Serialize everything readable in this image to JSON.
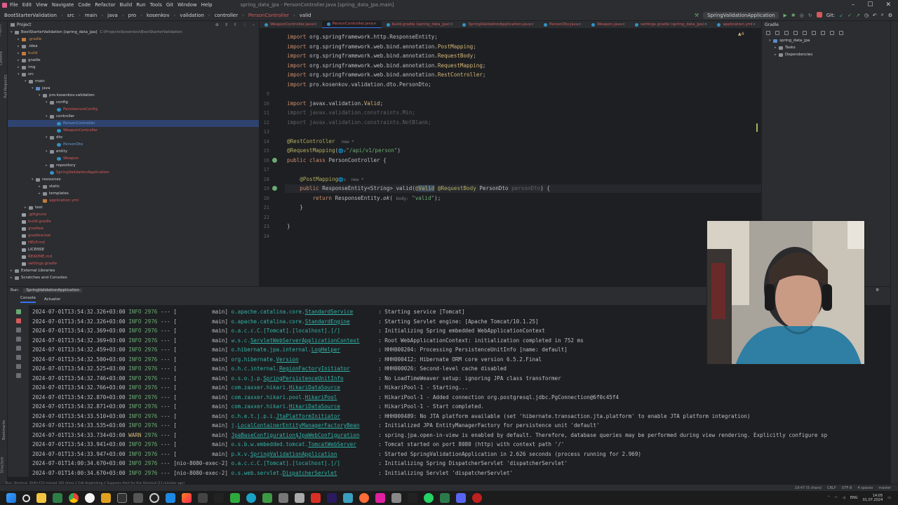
{
  "titlebar": {
    "menu": [
      "File",
      "Edit",
      "View",
      "Navigate",
      "Code",
      "Refactor",
      "Build",
      "Run",
      "Tools",
      "Git",
      "Window",
      "Help"
    ],
    "title": "spring_data_jpa - PersonController.java [spring_data_jpa.main]"
  },
  "navbar": {
    "crumbs": [
      "BootStarterValidation",
      "src",
      "main",
      "java",
      "pro",
      "kosenkov",
      "validation",
      "controller",
      "PersonController",
      "valid"
    ],
    "run_config": "SpringValidationApplication",
    "git_label": "Git:"
  },
  "project": {
    "header": "Project",
    "tree": [
      {
        "label": "BootStarterValidation [spring_data_jpa]",
        "suffix": "C:\\Projects\\kosenkov\\BootStarterValidation",
        "depth": 0,
        "icon": "folder",
        "color": "normal",
        "open": true
      },
      {
        "label": ".gradle",
        "depth": 1,
        "icon": "excl",
        "color": "orange"
      },
      {
        "label": ".idea",
        "depth": 1,
        "icon": "folder",
        "color": "normal"
      },
      {
        "label": "build",
        "depth": 1,
        "icon": "excl",
        "color": "orange"
      },
      {
        "label": "gradle",
        "depth": 1,
        "icon": "folder",
        "color": "normal"
      },
      {
        "label": "img",
        "depth": 1,
        "icon": "folder",
        "color": "normal"
      },
      {
        "label": "src",
        "depth": 1,
        "icon": "folder",
        "color": "normal",
        "open": true
      },
      {
        "label": "main",
        "depth": 2,
        "icon": "folder",
        "color": "normal",
        "open": true
      },
      {
        "label": "java",
        "depth": 3,
        "icon": "src",
        "color": "normal",
        "open": true
      },
      {
        "label": "pro.kosenkov.validation",
        "depth": 4,
        "icon": "folder",
        "color": "normal",
        "open": true
      },
      {
        "label": "config",
        "depth": 5,
        "icon": "folder",
        "color": "normal",
        "open": true
      },
      {
        "label": "PersistenceConfig",
        "depth": 6,
        "icon": "java",
        "color": "red"
      },
      {
        "label": "controller",
        "depth": 5,
        "icon": "folder",
        "color": "normal",
        "open": true
      },
      {
        "label": "PersonController",
        "depth": 6,
        "icon": "java",
        "color": "blue",
        "selected": true
      },
      {
        "label": "WeaponController",
        "depth": 6,
        "icon": "java",
        "color": "red"
      },
      {
        "label": "dto",
        "depth": 5,
        "icon": "folder",
        "color": "normal",
        "open": true
      },
      {
        "label": "PersonDto",
        "depth": 6,
        "icon": "java",
        "color": "blue"
      },
      {
        "label": "entity",
        "depth": 5,
        "icon": "folder",
        "color": "normal",
        "open": true
      },
      {
        "label": "Weapon",
        "depth": 6,
        "icon": "java",
        "color": "red"
      },
      {
        "label": "repository",
        "depth": 5,
        "icon": "folder",
        "color": "normal"
      },
      {
        "label": "SpringValidationApplication",
        "depth": 5,
        "icon": "java",
        "color": "red"
      },
      {
        "label": "resources",
        "depth": 3,
        "icon": "folder",
        "color": "normal",
        "open": true
      },
      {
        "label": "static",
        "depth": 4,
        "icon": "folder",
        "color": "normal"
      },
      {
        "label": "templates",
        "depth": 4,
        "icon": "folder",
        "color": "normal"
      },
      {
        "label": "application.yml",
        "depth": 4,
        "icon": "excl",
        "color": "red"
      },
      {
        "label": "test",
        "depth": 2,
        "icon": "folder",
        "color": "normal"
      },
      {
        "label": ".gitignore",
        "depth": 1,
        "icon": "file",
        "color": "red"
      },
      {
        "label": "build.gradle",
        "depth": 1,
        "icon": "file",
        "color": "red"
      },
      {
        "label": "gradlew",
        "depth": 1,
        "icon": "file",
        "color": "red"
      },
      {
        "label": "gradlew.bat",
        "depth": 1,
        "icon": "file",
        "color": "red"
      },
      {
        "label": "HELP.md",
        "depth": 1,
        "icon": "file",
        "color": "red"
      },
      {
        "label": "LICENSE",
        "depth": 1,
        "icon": "file",
        "color": "normal"
      },
      {
        "label": "README.md",
        "depth": 1,
        "icon": "file",
        "color": "red"
      },
      {
        "label": "settings.gradle",
        "depth": 1,
        "icon": "file",
        "color": "red"
      },
      {
        "label": "External Libraries",
        "depth": 0,
        "icon": "folder",
        "color": "normal"
      },
      {
        "label": "Scratches and Consoles",
        "depth": 0,
        "icon": "folder",
        "color": "normal"
      }
    ]
  },
  "tabs": [
    {
      "label": "WeaponController.java",
      "active": false
    },
    {
      "label": "PersonController.java",
      "active": true
    },
    {
      "label": "build.gradle (spring_data_jpa)",
      "active": false
    },
    {
      "label": "SpringValidationApplication.java",
      "active": false
    },
    {
      "label": "PersonDto.java",
      "active": false
    },
    {
      "label": "Weapon.java",
      "active": false
    },
    {
      "label": "settings.gradle (spring_data_jpa)",
      "active": false
    },
    {
      "label": "application.yml",
      "active": false
    }
  ],
  "editor": {
    "warning_count": "4",
    "lines": [
      {
        "n": "",
        "html": "<span class='kw'>import</span> org.springframework.http.ResponseEntity;"
      },
      {
        "n": "",
        "html": "<span class='kw'>import</span> org.springframework.web.bind.annotation.<span class='warn'>PostMapping</span>;"
      },
      {
        "n": "",
        "html": "<span class='kw'>import</span> org.springframework.web.bind.annotation.<span class='warn'>RequestBody</span>;"
      },
      {
        "n": "",
        "html": "<span class='kw'>import</span> org.springframework.web.bind.annotation.<span class='warn'>RequestMapping</span>;"
      },
      {
        "n": "",
        "html": "<span class='kw'>import</span> org.springframework.web.bind.annotation.<span class='warn'>RestController</span>;"
      },
      {
        "n": "",
        "html": "<span class='kw'>import</span> pro.kosenkov.validation.dto.PersonDto;"
      },
      {
        "n": "9",
        "html": ""
      },
      {
        "n": "10",
        "html": "<span class='kw'>import</span> javax.validation.<span class='warn'>Valid</span>;"
      },
      {
        "n": "11",
        "html": "<span class='dim'>import javax.validation.constraints.Min;</span>"
      },
      {
        "n": "12",
        "html": "<span class='dim'>import javax.validation.constraints.NotBlank;</span>"
      },
      {
        "n": "13",
        "html": ""
      },
      {
        "n": "14",
        "html": "<span class='ann'>@RestController</span>  <span class='hint'>new *</span>"
      },
      {
        "n": "15",
        "html": "<span class='ann'>@RequestMapping</span>(<span class='hint'>&#x1f310;&#x2228;</span><span class='str'>\"/api/v1/person\"</span>)"
      },
      {
        "n": "16",
        "html": "<span class='kw'>public class</span> PersonController {"
      },
      {
        "n": "17",
        "html": ""
      },
      {
        "n": "18",
        "html": "    <span class='ann'>@PostMapping</span><span class='hint'>&#x1f310;&#x2228;  new *</span>"
      },
      {
        "n": "19",
        "html": "    <span class='kw'>public</span> ResponseEntity&lt;String&gt; valid(<span class='ann'>@<span class='hl'>Valid</span></span> <span class='ann'>@RequestBody</span> PersonDto <span class='dim'>personDto</span>) {"
      },
      {
        "n": "20",
        "html": "        <span class='kw'>return</span> ResponseEntity.<i>ok</i>( <span class='hint'>body:</span> <span class='str'>\"valid\"</span>);"
      },
      {
        "n": "21",
        "html": "    }"
      },
      {
        "n": "22",
        "html": ""
      },
      {
        "n": "23",
        "html": "}"
      },
      {
        "n": "24",
        "html": ""
      }
    ]
  },
  "gradle": {
    "header": "Gradle",
    "tree": [
      {
        "label": "spring_data_jpa",
        "depth": 0
      },
      {
        "label": "Tasks",
        "depth": 1
      },
      {
        "label": "Dependencies",
        "depth": 1
      }
    ]
  },
  "run": {
    "label": "Run:",
    "config": "SpringValidationApplication",
    "tabs": [
      "Console",
      "Actuator"
    ],
    "log": [
      {
        "ts": "2024-07-01T13:54:32.326+03:00",
        "lvl": "INFO",
        "pid": "2976",
        "thr": "[           main]",
        "logger": "o.apache.catalina.core.",
        "cls": "StandardService",
        "msg": ": Starting service [Tomcat]"
      },
      {
        "ts": "2024-07-01T13:54:32.326+03:00",
        "lvl": "INFO",
        "pid": "2976",
        "thr": "[           main]",
        "logger": "o.apache.catalina.core.",
        "cls": "StandardEngine",
        "msg": ": Starting Servlet engine: [Apache Tomcat/10.1.25]"
      },
      {
        "ts": "2024-07-01T13:54:32.369+03:00",
        "lvl": "INFO",
        "pid": "2976",
        "thr": "[           main]",
        "logger": "o.a.c.c.C.[Tomcat].[localhost].[/]",
        "cls": "",
        "msg": ": Initializing Spring embedded WebApplicationContext"
      },
      {
        "ts": "2024-07-01T13:54:32.369+03:00",
        "lvl": "INFO",
        "pid": "2976",
        "thr": "[           main]",
        "logger": "w.s.c.",
        "cls": "ServletWebServerApplicationContext",
        "msg": ": Root WebApplicationContext: initialization completed in 752 ms"
      },
      {
        "ts": "2024-07-01T13:54:32.459+03:00",
        "lvl": "INFO",
        "pid": "2976",
        "thr": "[           main]",
        "logger": "o.hibernate.jpa.internal.",
        "cls": "LogHelper",
        "msg": ": HHH000204: Processing PersistenceUnitInfo [name: default]"
      },
      {
        "ts": "2024-07-01T13:54:32.500+03:00",
        "lvl": "INFO",
        "pid": "2976",
        "thr": "[           main]",
        "logger": "org.hibernate.",
        "cls": "Version",
        "msg": ": HHH000412: Hibernate ORM core version 6.5.2.Final"
      },
      {
        "ts": "2024-07-01T13:54:32.525+03:00",
        "lvl": "INFO",
        "pid": "2976",
        "thr": "[           main]",
        "logger": "o.h.c.internal.",
        "cls": "RegionFactoryInitiator",
        "msg": ": HHH000026: Second-level cache disabled"
      },
      {
        "ts": "2024-07-01T13:54:32.746+03:00",
        "lvl": "INFO",
        "pid": "2976",
        "thr": "[           main]",
        "logger": "o.s.o.j.p.",
        "cls": "SpringPersistenceUnitInfo",
        "msg": ": No LoadTimeWeaver setup: ignoring JPA class transformer"
      },
      {
        "ts": "2024-07-01T13:54:32.766+03:00",
        "lvl": "INFO",
        "pid": "2976",
        "thr": "[           main]",
        "logger": "com.zaxxer.hikari.",
        "cls": "HikariDataSource",
        "msg": ": HikariPool-1 - Starting..."
      },
      {
        "ts": "2024-07-01T13:54:32.870+03:00",
        "lvl": "INFO",
        "pid": "2976",
        "thr": "[           main]",
        "logger": "com.zaxxer.hikari.pool.",
        "cls": "HikariPool",
        "msg": ": HikariPool-1 - Added connection org.postgresql.jdbc.PgConnection@6f0c45f4"
      },
      {
        "ts": "2024-07-01T13:54:32.871+03:00",
        "lvl": "INFO",
        "pid": "2976",
        "thr": "[           main]",
        "logger": "com.zaxxer.hikari.",
        "cls": "HikariDataSource",
        "msg": ": HikariPool-1 - Start completed."
      },
      {
        "ts": "2024-07-01T13:54:33.510+03:00",
        "lvl": "INFO",
        "pid": "2976",
        "thr": "[           main]",
        "logger": "o.h.e.t.j.p.i.",
        "cls": "JtaPlatformInitiator",
        "msg": ": HHH000489: No JTA platform available (set 'hibernate.transaction.jta.platform' to enable JTA platform integration)"
      },
      {
        "ts": "2024-07-01T13:54:33.535+03:00",
        "lvl": "INFO",
        "pid": "2976",
        "thr": "[           main]",
        "logger": "j.",
        "cls": "LocalContainerEntityManagerFactoryBean",
        "msg": ": Initialized JPA EntityManagerFactory for persistence unit 'default'"
      },
      {
        "ts": "2024-07-01T13:54:33.734+03:00",
        "lvl": "WARN",
        "pid": "2976",
        "thr": "[           main]",
        "logger": "",
        "cls": "JpaBaseConfiguration$JpaWebConfiguration",
        "msg": ": spring.jpa.open-in-view is enabled by default. Therefore, database queries may be performed during view rendering. Explicitly configure sp"
      },
      {
        "ts": "2024-07-01T13:54:33.941+03:00",
        "lvl": "INFO",
        "pid": "2976",
        "thr": "[           main]",
        "logger": "o.s.b.w.embedded.tomcat.",
        "cls": "TomcatWebServer",
        "msg": ": Tomcat started on port 8080 (http) with context path '/'"
      },
      {
        "ts": "2024-07-01T13:54:33.947+03:00",
        "lvl": "INFO",
        "pid": "2976",
        "thr": "[           main]",
        "logger": "p.k.v.",
        "cls": "SpringValidationApplication",
        "msg": ": Started SpringValidationApplication in 2.626 seconds (process running for 2.969)"
      },
      {
        "ts": "2024-07-01T14:00:34.670+03:00",
        "lvl": "INFO",
        "pid": "2976",
        "thr": "[nio-8080-exec-2]",
        "logger": "o.a.c.c.C.[Tomcat].[localhost].[/]",
        "cls": "",
        "msg": ": Initializing Spring DispatcherServlet 'dispatcherServlet'"
      },
      {
        "ts": "2024-07-01T14:00:34.670+03:00",
        "lvl": "INFO",
        "pid": "2976",
        "thr": "[nio-8080-exec-2]",
        "logger": "o.s.web.servlet.",
        "cls": "DispatcherServlet",
        "msg": ": Initializing Servlet 'dispatcherServlet'"
      }
    ]
  },
  "bottom_tabs": [
    "Git",
    "Run",
    "TODO",
    "Problems",
    "Terminal",
    "Services",
    "Profiler",
    "Database Changes",
    "Build"
  ],
  "statusbar": {
    "left": "Run: Shortcut: Shift+F10 missed 165 times // Edit Keybinding // Suppress Alert for this Shortcut (11 minutes ago)",
    "right": [
      "19:47 (5 chars)",
      "CRLF",
      "UTF-8",
      "4 spaces",
      "master"
    ]
  },
  "taskbar": {
    "lang": "ENG",
    "time": "14:05",
    "date": "01.07.2024"
  },
  "colors": {
    "accent": "#3574f0",
    "editor_bg": "#1e1f22",
    "panel_bg": "#2b2d30",
    "keyword": "#cf8e6d",
    "annotation": "#b3ae60",
    "string": "#6aab73"
  }
}
